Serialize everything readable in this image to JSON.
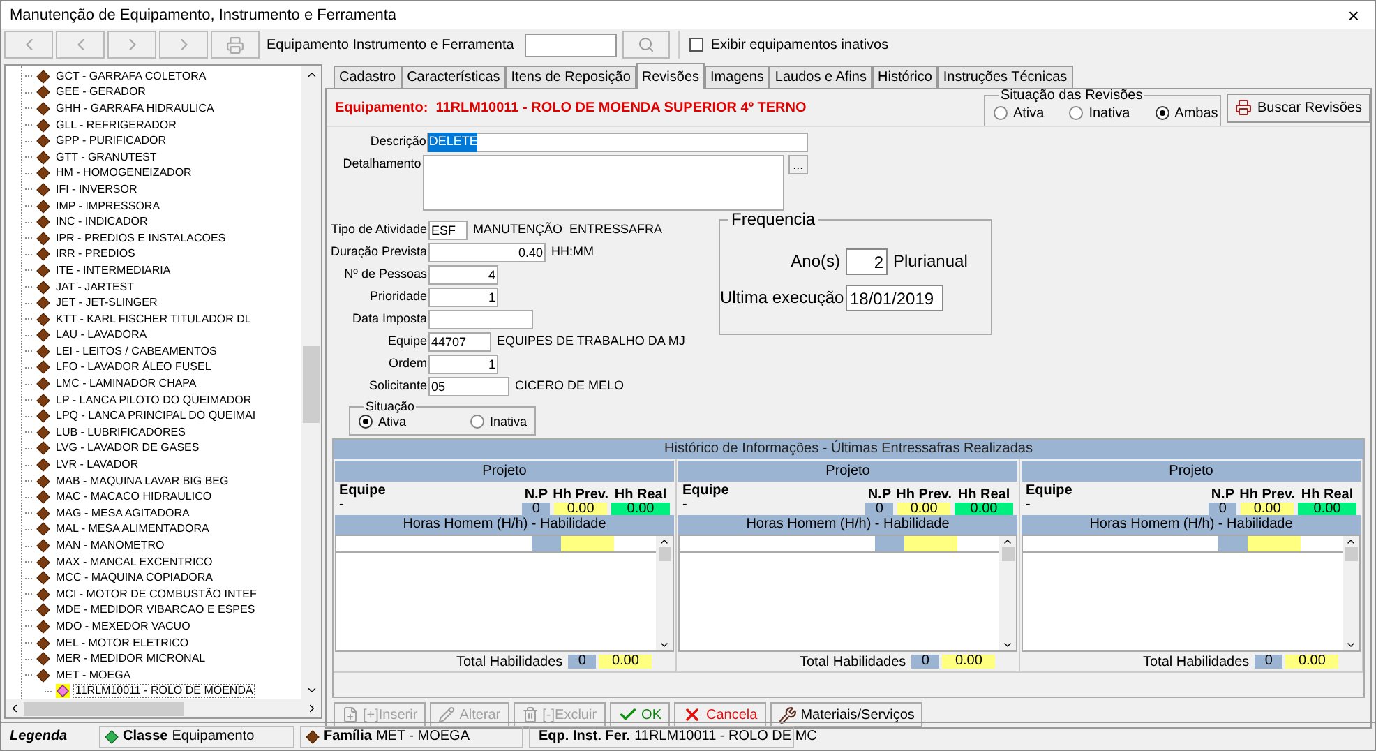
{
  "window": {
    "title": "Manutenção de Equipamento, Instrumento e Ferramenta",
    "close": "×"
  },
  "toolbar": {
    "buttons": [
      {
        "kind": "first",
        "disabled": true
      },
      {
        "kind": "prev",
        "disabled": true
      },
      {
        "kind": "next",
        "disabled": true
      },
      {
        "kind": "last",
        "disabled": true
      },
      {
        "kind": "print",
        "disabled": true
      }
    ],
    "search_label": "Equipamento Instrumento e Ferramenta",
    "show_inactive": {
      "label": "Exibir equipamentos inativos",
      "checked": false
    }
  },
  "tree": [
    {
      "label": "GCT - GARRAFA COLETORA",
      "selected": false
    },
    {
      "label": "GEE - GERADOR",
      "selected": false
    },
    {
      "label": "GHH - GARRAFA HIDRAULICA",
      "selected": false
    },
    {
      "label": "GLL - REFRIGERADOR",
      "selected": false
    },
    {
      "label": "GPP - PURIFICADOR",
      "selected": false
    },
    {
      "label": "GTT - GRANUTEST",
      "selected": false
    },
    {
      "label": "HM - HOMOGENEIZADOR",
      "selected": false
    },
    {
      "label": "IFI - INVERSOR",
      "selected": false
    },
    {
      "label": "IMP - IMPRESSORA",
      "selected": false
    },
    {
      "label": "INC - INDICADOR",
      "selected": false
    },
    {
      "label": "IPR - PREDIOS E INSTALACOES",
      "selected": false
    },
    {
      "label": "IRR - PREDIOS",
      "selected": false
    },
    {
      "label": "ITE - INTERMEDIARIA",
      "selected": false
    },
    {
      "label": "JAT - JARTEST",
      "selected": false
    },
    {
      "label": "JET - JET-SLINGER",
      "selected": false
    },
    {
      "label": "KTT - KARL FISCHER TITULADOR DL",
      "selected": false
    },
    {
      "label": "LAU - LAVADORA",
      "selected": false
    },
    {
      "label": "LEI - LEITOS / CABEAMENTOS",
      "selected": false
    },
    {
      "label": "LFO - LAVADOR ÁLEO FUSEL",
      "selected": false
    },
    {
      "label": "LMC - LAMINADOR CHAPA",
      "selected": false
    },
    {
      "label": "LP - LANCA PILOTO DO QUEIMADOR",
      "selected": false
    },
    {
      "label": "LPQ - LANCA PRINCIPAL DO QUEIMAI",
      "selected": false
    },
    {
      "label": "LUB - LUBRIFICADORES",
      "selected": false
    },
    {
      "label": "LVG - LAVADOR DE GASES",
      "selected": false
    },
    {
      "label": "LVR - LAVADOR",
      "selected": false
    },
    {
      "label": "MAB - MAQUINA LAVAR BIG BEG",
      "selected": false
    },
    {
      "label": "MAC - MACACO HIDRAULICO",
      "selected": false
    },
    {
      "label": "MAG - MESA AGITADORA",
      "selected": false
    },
    {
      "label": "MAL - MESA ALIMENTADORA",
      "selected": false
    },
    {
      "label": "MAN - MANOMETRO",
      "selected": false
    },
    {
      "label": "MAX - MANCAL EXCENTRICO",
      "selected": false
    },
    {
      "label": "MCC - MAQUINA COPIADORA",
      "selected": false
    },
    {
      "label": "MCI - MOTOR DE COMBUSTÃO INTEF",
      "selected": false
    },
    {
      "label": "MDE - MEDIDOR VIBARCAO E ESPES",
      "selected": false
    },
    {
      "label": "MDO - MEXEDOR VACUO",
      "selected": false
    },
    {
      "label": "MEL - MOTOR ELETRICO",
      "selected": false
    },
    {
      "label": "MER - MEDIDOR MICRONAL",
      "selected": false
    },
    {
      "label": "MET - MOEGA",
      "selected": false,
      "children": [
        {
          "label": "11RLM10011 - ROLO DE MOENDA",
          "selected": true
        }
      ]
    }
  ],
  "tabs": [
    {
      "label": "Cadastro",
      "selected": false
    },
    {
      "label": "Características",
      "selected": false
    },
    {
      "label": "Itens de Reposição",
      "selected": false
    },
    {
      "label": "Revisões",
      "selected": true
    },
    {
      "label": "Imagens",
      "selected": false
    },
    {
      "label": "Laudos e Afins",
      "selected": false
    },
    {
      "label": "Histórico",
      "selected": false
    },
    {
      "label": "Instruções Técnicas",
      "selected": false
    }
  ],
  "equipment_title": "Equipamento:  11RLM10011 - ROLO DE MOENDA SUPERIOR 4º TERNO",
  "revision_filter": {
    "title": "Situação das Revisões",
    "options": [
      {
        "label": "Ativa",
        "selected": false
      },
      {
        "label": "Inativa",
        "selected": false
      },
      {
        "label": "Ambas",
        "selected": true
      }
    ]
  },
  "search_button": "Buscar Revisões",
  "form": {
    "description": {
      "label": "Descrição",
      "value": "DELETE",
      "highlighted": true
    },
    "details": {
      "label": "Detalhamento",
      "button": "..."
    },
    "fields": [
      {
        "label": "Tipo de Atividade",
        "value": "ESF",
        "kind": "code",
        "note": "MANUTENÇÃO  ENTRESSAFRA"
      },
      {
        "label": "Duração Prevista",
        "value": "0.40",
        "kind": "long",
        "note": "HH:MM"
      },
      {
        "label": "Nº de Pessoas",
        "value": "4",
        "kind": "number"
      },
      {
        "label": "Prioridade",
        "value": "1",
        "kind": "number"
      },
      {
        "label": "Data Imposta",
        "kind": "date"
      },
      {
        "label": "Equipe",
        "value": "44707",
        "kind": "id",
        "note": "EQUIPES DE TRABALHO DA MJ"
      },
      {
        "label": "Ordem",
        "value": "1",
        "kind": "number"
      },
      {
        "label": "Solicitante",
        "value": "05",
        "kind": "text",
        "note": "CICERO DE MELO"
      }
    ],
    "status": {
      "title": "Situação",
      "options": [
        {
          "label": "Ativa",
          "selected": true
        },
        {
          "label": "Inativa",
          "selected": false
        }
      ]
    },
    "frequency": {
      "title": "Frequencia",
      "years_label": "Ano(s)",
      "years": "2",
      "years_note": "Plurianual",
      "last_label": "Ultima execução",
      "last": "18/01/2019"
    }
  },
  "history": {
    "title": "Histórico de Informações - Últimas Entressafras Realizadas",
    "panels": [
      {
        "header": "Projeto",
        "team_label": "Equipe",
        "team": "-",
        "np_label": "N.P",
        "prev_label": "Hh Prev.",
        "real_label": "Hh Real",
        "np": "0",
        "prev": "0.00",
        "real": "0.00",
        "skills_header": "Horas Homem (H/h) - Habilidade",
        "total_label": "Total Habilidades",
        "total_np": "0",
        "total_hh": "0.00"
      },
      {
        "header": "Projeto",
        "team_label": "Equipe",
        "team": "-",
        "np_label": "N.P",
        "prev_label": "Hh Prev.",
        "real_label": "Hh Real",
        "np": "0",
        "prev": "0.00",
        "real": "0.00",
        "skills_header": "Horas Homem (H/h) - Habilidade",
        "total_label": "Total Habilidades",
        "total_np": "0",
        "total_hh": "0.00"
      },
      {
        "header": "Projeto",
        "team_label": "Equipe",
        "team": "-",
        "np_label": "N.P",
        "prev_label": "Hh Prev.",
        "real_label": "Hh Real",
        "np": "0",
        "prev": "0.00",
        "real": "0.00",
        "skills_header": "Horas Homem (H/h) - Habilidade",
        "total_label": "Total Habilidades",
        "total_np": "0",
        "total_hh": "0.00"
      }
    ]
  },
  "actions": [
    {
      "label": "[+]Inserir",
      "kind": "insert",
      "disabled": true
    },
    {
      "label": "Alterar",
      "kind": "edit",
      "disabled": true
    },
    {
      "label": "[-]Excluir",
      "kind": "delete",
      "disabled": true
    },
    {
      "label": "OK",
      "kind": "ok",
      "disabled": false
    },
    {
      "label": "Cancela",
      "kind": "cancel",
      "disabled": false
    },
    {
      "label": "Materiais/Serviços",
      "kind": "materials",
      "disabled": false
    }
  ],
  "status_bar": {
    "legend": "Legenda",
    "items": [
      {
        "name": "Classe",
        "value": "Equipamento",
        "kind": "class"
      },
      {
        "name": "Família",
        "value": "MET - MOEGA",
        "kind": "family"
      },
      {
        "name": "Eqp. Inst. Fer.",
        "value": "11RLM10011 - ROLO DE MC",
        "kind": "equipment"
      }
    ]
  }
}
